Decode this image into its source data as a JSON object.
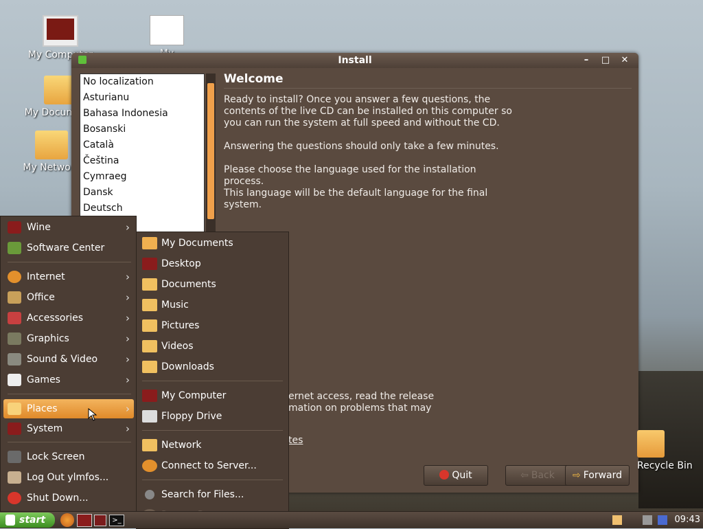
{
  "desktop": {
    "icons": [
      {
        "label": "My Computer"
      },
      {
        "label": "My Documents"
      },
      {
        "label": "My Network"
      },
      {
        "label": "My Spreadsheet"
      }
    ],
    "recycle_label": "Recycle Bin"
  },
  "window": {
    "title": "Install",
    "controls": {
      "minimize": "–",
      "maximize": "□",
      "close": "✕"
    },
    "languages": [
      "No localization",
      "Asturianu",
      "Bahasa Indonesia",
      "Bosanski",
      "Català",
      "Čeština",
      "Cymraeg",
      "Dansk",
      "Deutsch"
    ],
    "heading": "Welcome",
    "para1": [
      "Ready to install? Once you answer a few questions, the",
      "contents of the live CD can be installed on this computer so",
      "you can run the system at full speed and without the CD."
    ],
    "para2": "Answering the questions should only take a few minutes.",
    "para3": [
      "Please choose the language used for the installation process.",
      "This language will be the default language for the final system."
    ],
    "partial1": "ernet access, read the release",
    "partial2": "mation on problems that may",
    "partial_link": "tes",
    "buttons": {
      "quit": "Quit",
      "back": "Back",
      "forward": "Forward"
    }
  },
  "start_menu": {
    "items": [
      {
        "label": "Wine",
        "arrow": "›"
      },
      {
        "label": "Software Center",
        "arrow": ""
      },
      {
        "label": "Internet",
        "arrow": "›"
      },
      {
        "label": "Office",
        "arrow": "›"
      },
      {
        "label": "Accessories",
        "arrow": "›"
      },
      {
        "label": "Graphics",
        "arrow": "›"
      },
      {
        "label": "Sound & Video",
        "arrow": "›"
      },
      {
        "label": "Games",
        "arrow": "›"
      },
      {
        "label": "Places",
        "arrow": "›"
      },
      {
        "label": "System",
        "arrow": "›"
      },
      {
        "label": "Lock Screen",
        "arrow": ""
      },
      {
        "label": "Log Out ylmfos...",
        "arrow": ""
      },
      {
        "label": "Shut Down...",
        "arrow": ""
      }
    ]
  },
  "places_menu": {
    "items": [
      "My Documents",
      "Desktop",
      "Documents",
      "Music",
      "Pictures",
      "Videos",
      "Downloads",
      "My Computer",
      "Floppy Drive",
      "Network",
      "Connect to Server...",
      "Search for Files...",
      "Recent Documents"
    ],
    "recent_arrow": "›"
  },
  "taskbar": {
    "start_label": "start",
    "clock": "09:43"
  },
  "colors": {
    "accent": "#e08a2a",
    "window_bg": "#5a4a3f",
    "menu_bg": "#4b3d34",
    "start_green": "#3c8d21"
  }
}
